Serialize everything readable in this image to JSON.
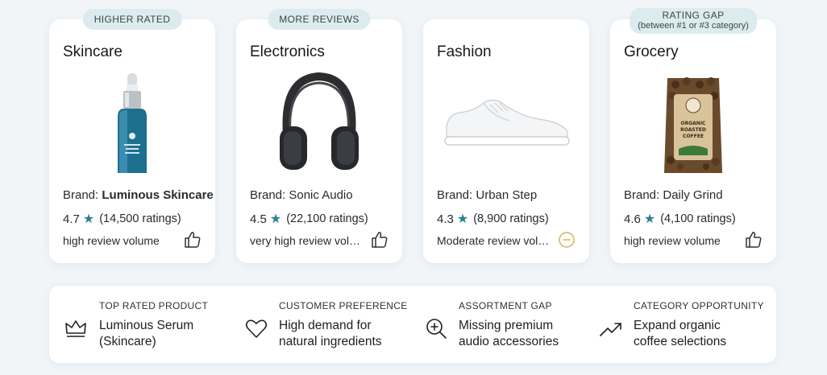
{
  "cards": [
    {
      "badge": "HIGHER RATED",
      "category": "Skincare",
      "brand_prefix": "Brand: ",
      "brand_name": "Luminous Skincare",
      "score": "4.7",
      "ratings": "(14,500 ratings)",
      "volume": "high review volume",
      "volume_icon": "thumbs-up-icon",
      "product_icon": "serum-bottle-icon"
    },
    {
      "badge": "MORE REVIEWS",
      "category": "Electronics",
      "brand_text": "Brand: Sonic Audio",
      "score": "4.5",
      "ratings": "(22,100 ratings)",
      "volume": "very high review volume",
      "volume_icon": "thumbs-up-icon",
      "product_icon": "headphones-icon"
    },
    {
      "category": "Fashion",
      "brand_text": "Brand: Urban Step",
      "score": "4.3",
      "ratings": "(8,900 ratings)",
      "volume": "Moderate review volume",
      "volume_icon": "neutral-circle-icon",
      "product_icon": "sneaker-icon"
    },
    {
      "badge": "RATING GAP",
      "badge_sub": "(between #1 or #3 category)",
      "category": "Grocery",
      "brand_text": "Brand: Daily Grind",
      "score": "4.6",
      "ratings": "(4,100 ratings)",
      "volume": "high review volume",
      "volume_icon": "thumbs-up-icon",
      "product_icon": "coffee-bag-icon",
      "package_label": "ORGANIC ROASTED COFFEE"
    }
  ],
  "insights": [
    {
      "label": "TOP RATED PRODUCT",
      "line1": "Luminous Serum",
      "line2": "(Skincare)",
      "icon": "crown-icon"
    },
    {
      "label": "CUSTOMER PREFERENCE",
      "line1": "High demand for",
      "line2": "natural ingredients",
      "icon": "heart-icon"
    },
    {
      "label": "ASSORTMENT GAP",
      "line1": "Missing premium",
      "line2": "audio accessories",
      "icon": "zoom-in-icon"
    },
    {
      "label": "CATEGORY OPPORTUNITY",
      "line1": "Expand organic",
      "line2": "coffee selections",
      "icon": "trend-up-icon"
    }
  ],
  "colors": {
    "accent_star": "#2a8193",
    "badge_bg": "#dcecee",
    "neutral_icon": "#d9b25a"
  }
}
